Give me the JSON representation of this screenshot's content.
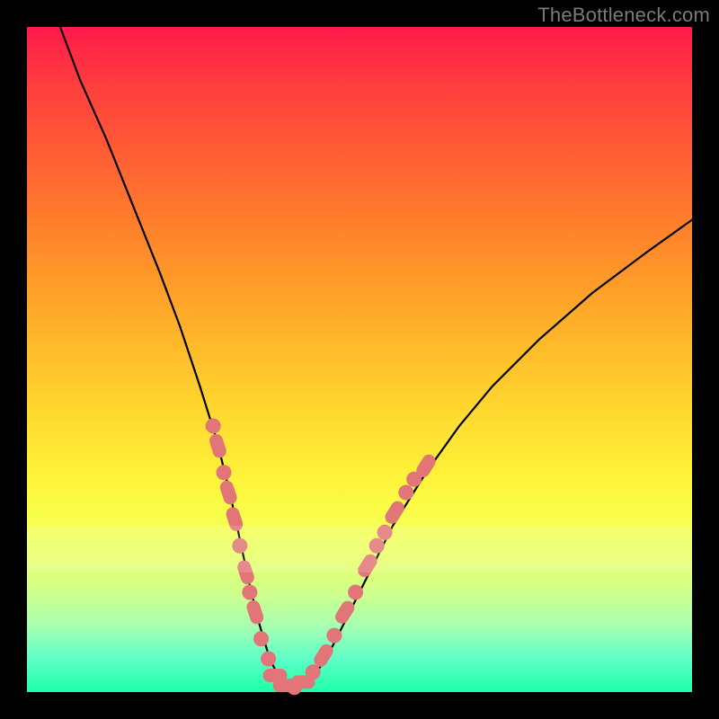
{
  "watermark": "TheBottleneck.com",
  "colors": {
    "curve_stroke": "#000000",
    "marker_fill": "#e17577",
    "marker_stroke": "#e17577"
  },
  "chart_data": {
    "type": "line",
    "title": "",
    "xlabel": "",
    "ylabel": "",
    "xlim": [
      0,
      100
    ],
    "ylim": [
      0,
      100
    ],
    "series": [
      {
        "name": "bottleneck-curve",
        "x": [
          5,
          8,
          12,
          16,
          20,
          23,
          26,
          28.5,
          30.5,
          32,
          33.5,
          35,
          36.5,
          38,
          39.5,
          41,
          43,
          46,
          50,
          55,
          60,
          65,
          70,
          77,
          85,
          93,
          100
        ],
        "y": [
          100,
          92,
          83,
          73,
          63,
          55,
          46,
          38,
          30,
          23,
          16,
          10,
          5,
          2,
          0.5,
          0.5,
          2,
          7,
          15,
          25,
          33,
          40,
          46,
          53,
          60,
          66,
          71
        ]
      }
    ],
    "markers": [
      {
        "x": 28.0,
        "y": 40,
        "shape": "circle"
      },
      {
        "x": 28.7,
        "y": 37,
        "shape": "pill-v"
      },
      {
        "x": 29.6,
        "y": 33,
        "shape": "circle"
      },
      {
        "x": 30.3,
        "y": 30,
        "shape": "pill-v"
      },
      {
        "x": 31.2,
        "y": 26,
        "shape": "pill-v"
      },
      {
        "x": 32.0,
        "y": 22,
        "shape": "circle"
      },
      {
        "x": 32.9,
        "y": 18,
        "shape": "pill-v"
      },
      {
        "x": 33.5,
        "y": 15,
        "shape": "circle"
      },
      {
        "x": 34.3,
        "y": 12,
        "shape": "pill-v"
      },
      {
        "x": 35.2,
        "y": 8,
        "shape": "circle"
      },
      {
        "x": 36.3,
        "y": 5,
        "shape": "circle"
      },
      {
        "x": 37.3,
        "y": 2.5,
        "shape": "pill-h"
      },
      {
        "x": 38.8,
        "y": 1.0,
        "shape": "pill-h"
      },
      {
        "x": 40.2,
        "y": 0.7,
        "shape": "circle"
      },
      {
        "x": 41.5,
        "y": 1.5,
        "shape": "pill-h"
      },
      {
        "x": 43.0,
        "y": 3.0,
        "shape": "circle"
      },
      {
        "x": 44.6,
        "y": 5.5,
        "shape": "pill-d"
      },
      {
        "x": 46.2,
        "y": 8.5,
        "shape": "circle"
      },
      {
        "x": 47.8,
        "y": 12,
        "shape": "pill-d"
      },
      {
        "x": 49.4,
        "y": 15,
        "shape": "circle"
      },
      {
        "x": 51.2,
        "y": 19,
        "shape": "pill-d"
      },
      {
        "x": 52.6,
        "y": 22,
        "shape": "circle"
      },
      {
        "x": 53.8,
        "y": 24,
        "shape": "circle"
      },
      {
        "x": 55.3,
        "y": 27,
        "shape": "pill-d"
      },
      {
        "x": 57.0,
        "y": 30,
        "shape": "circle"
      },
      {
        "x": 58.2,
        "y": 32,
        "shape": "circle"
      },
      {
        "x": 60.0,
        "y": 34,
        "shape": "pill-d"
      }
    ]
  }
}
